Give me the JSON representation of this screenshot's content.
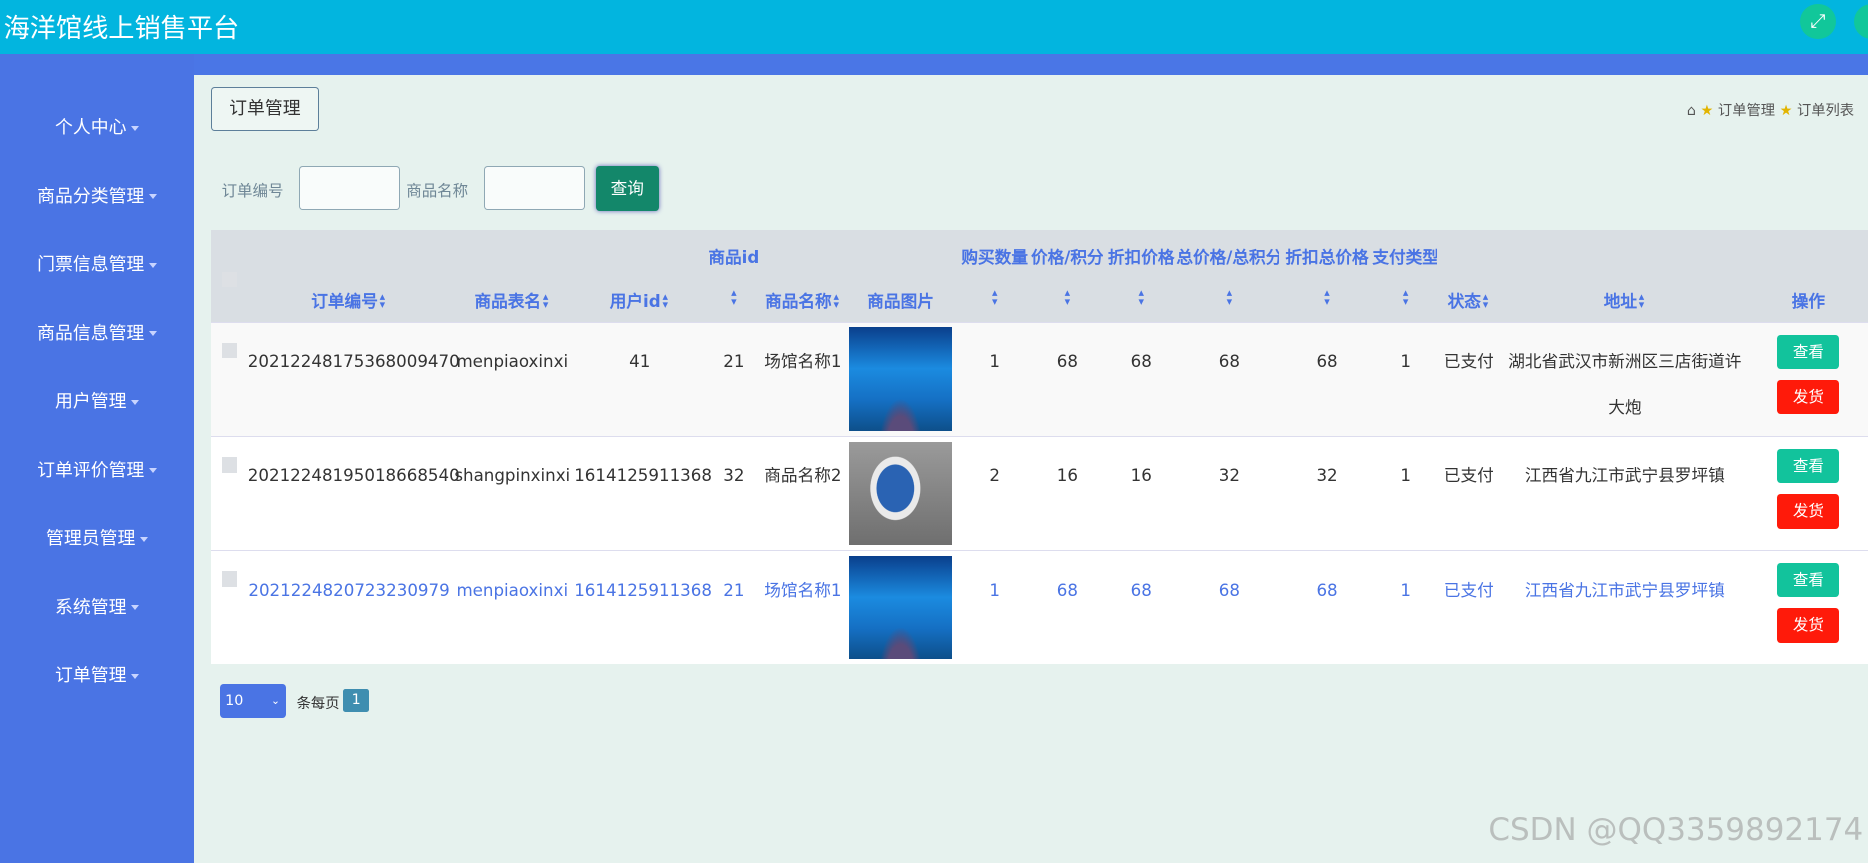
{
  "app": {
    "title": "海洋馆线上销售平台"
  },
  "sidebar": {
    "items": [
      {
        "label": "个人中心"
      },
      {
        "label": "商品分类管理"
      },
      {
        "label": "门票信息管理"
      },
      {
        "label": "商品信息管理"
      },
      {
        "label": "用户管理"
      },
      {
        "label": "订单评价管理"
      },
      {
        "label": "管理员管理"
      },
      {
        "label": "系统管理"
      },
      {
        "label": "订单管理"
      }
    ]
  },
  "breadcrumb": {
    "button": "订单管理",
    "items": [
      "订单管理",
      "订单列表"
    ]
  },
  "search": {
    "order_no_label": "订单编号",
    "order_no_value": "",
    "product_name_label": "商品名称",
    "product_name_value": "",
    "query_label": "查询"
  },
  "table": {
    "columns": [
      {
        "label": "",
        "sort": false
      },
      {
        "label": "订单编号",
        "sort": true
      },
      {
        "label": "商品表名",
        "sort": true
      },
      {
        "label": "用户id",
        "sort": true
      },
      {
        "label": "商品id",
        "sort": true,
        "top": true
      },
      {
        "label": "商品名称",
        "sort": true
      },
      {
        "label": "商品图片",
        "sort": false
      },
      {
        "label": "购买数量",
        "sort": true,
        "top": true
      },
      {
        "label": "价格/积分",
        "sort": true,
        "top": true
      },
      {
        "label": "折扣价格",
        "sort": true,
        "top": true
      },
      {
        "label": "总价格/总积分",
        "sort": true,
        "top": true
      },
      {
        "label": "折扣总价格",
        "sort": true,
        "top": true
      },
      {
        "label": "支付类型",
        "sort": true,
        "top": true
      },
      {
        "label": "状态",
        "sort": true
      },
      {
        "label": "地址",
        "sort": true
      },
      {
        "label": "操作",
        "sort": false
      }
    ],
    "rows": [
      {
        "order_no": "20212248175368009470",
        "table_name": "menpiaoxinxi",
        "user_id": "41",
        "product_id": "21",
        "product_name": "场馆名称1",
        "image": "aquarium-tunnel",
        "quantity": "1",
        "price": "68",
        "discount_price": "68",
        "total": "68",
        "discount_total": "68",
        "pay_type": "1",
        "status": "已支付",
        "address": "湖北省武汉市新洲区三店街道许大炮"
      },
      {
        "order_no": "20212248195018668540",
        "table_name": "shangpinxinxi",
        "user_id": "1614125911368",
        "product_id": "32",
        "product_name": "商品名称2",
        "image": "shark-souvenir",
        "quantity": "2",
        "price": "16",
        "discount_price": "16",
        "total": "32",
        "discount_total": "32",
        "pay_type": "1",
        "status": "已支付",
        "address": "江西省九江市武宁县罗坪镇"
      },
      {
        "order_no": "2021224820723230979",
        "table_name": "menpiaoxinxi",
        "user_id": "1614125911368",
        "product_id": "21",
        "product_name": "场馆名称1",
        "image": "aquarium-tunnel",
        "quantity": "1",
        "price": "68",
        "discount_price": "68",
        "total": "68",
        "discount_total": "68",
        "pay_type": "1",
        "status": "已支付",
        "address": "江西省九江市武宁县罗坪镇"
      }
    ],
    "view_label": "查看",
    "ship_label": "发货"
  },
  "pagination": {
    "page_size": "10",
    "per_page_label": "条每页",
    "current_page": "1"
  },
  "watermark": "CSDN @QQ3359892174",
  "colors": {
    "header": "#02b5df",
    "sidebar": "#4a74e4",
    "view": "#12c39c",
    "ship": "#ff1a0a",
    "query": "#13876a"
  }
}
